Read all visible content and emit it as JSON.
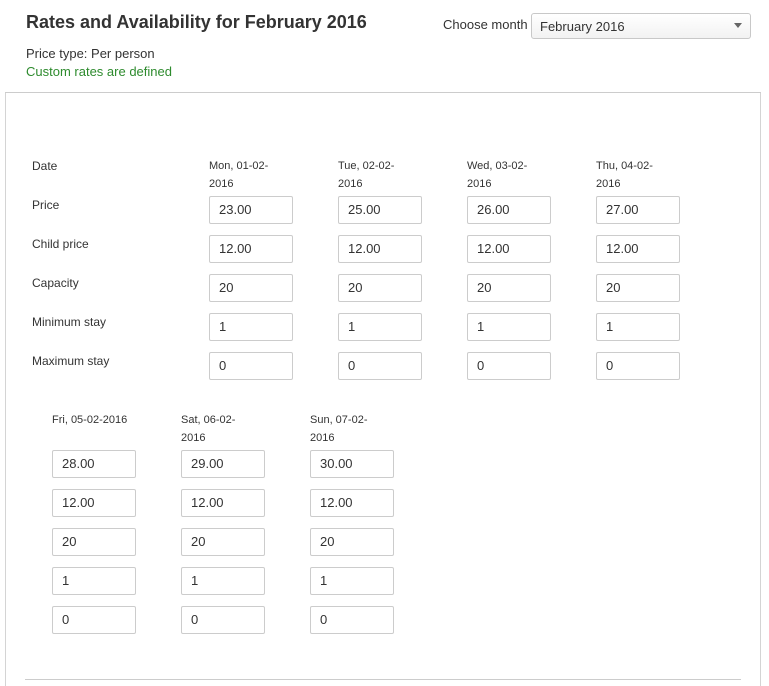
{
  "header": {
    "title": "Rates and Availability for February 2016",
    "price_type": "Price type: Per person",
    "custom_rates": "Custom rates are defined",
    "month_label": "Choose month",
    "month_value": "February 2016"
  },
  "row_labels": {
    "date": "Date",
    "price": "Price",
    "child_price": "Child price",
    "capacity": "Capacity",
    "minimum_stay": "Minimum stay",
    "maximum_stay": "Maximum stay"
  },
  "days": [
    {
      "date_line1": "Mon, 01-02-",
      "date_line2": "2016",
      "price": "23.00",
      "child_price": "12.00",
      "capacity": "20",
      "min_stay": "1",
      "max_stay": "0"
    },
    {
      "date_line1": "Tue, 02-02-",
      "date_line2": "2016",
      "price": "25.00",
      "child_price": "12.00",
      "capacity": "20",
      "min_stay": "1",
      "max_stay": "0"
    },
    {
      "date_line1": "Wed, 03-02-",
      "date_line2": "2016",
      "price": "26.00",
      "child_price": "12.00",
      "capacity": "20",
      "min_stay": "1",
      "max_stay": "0"
    },
    {
      "date_line1": "Thu, 04-02-",
      "date_line2": "2016",
      "price": "27.00",
      "child_price": "12.00",
      "capacity": "20",
      "min_stay": "1",
      "max_stay": "0"
    },
    {
      "date_line1": "Fri, 05-02-2016",
      "date_line2": "",
      "price": "28.00",
      "child_price": "12.00",
      "capacity": "20",
      "min_stay": "1",
      "max_stay": "0"
    },
    {
      "date_line1": "Sat, 06-02-",
      "date_line2": "2016",
      "price": "29.00",
      "child_price": "12.00",
      "capacity": "20",
      "min_stay": "1",
      "max_stay": "0"
    },
    {
      "date_line1": "Sun, 07-02-",
      "date_line2": "2016",
      "price": "30.00",
      "child_price": "12.00",
      "capacity": "20",
      "min_stay": "1",
      "max_stay": "0"
    }
  ]
}
